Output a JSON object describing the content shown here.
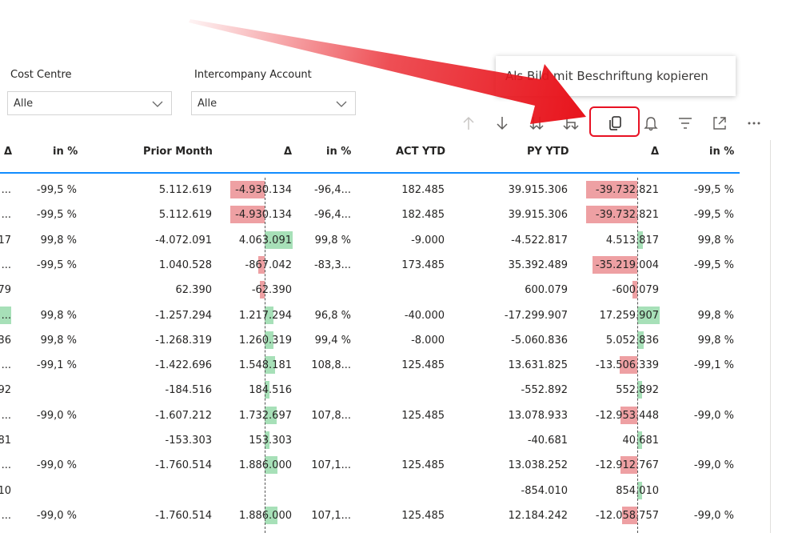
{
  "filters": {
    "cost_centre": {
      "label": "Cost Centre",
      "value": "Alle"
    },
    "intercompany": {
      "label": "Intercompany Account",
      "value": "Alle"
    }
  },
  "tooltip": {
    "text": "Als Bild mit Beschriftung kopieren"
  },
  "toolbar": {
    "icons": [
      "arrow-up-icon",
      "arrow-down-icon",
      "drill-all-down-icon",
      "expand-next-level-icon",
      "copy-icon",
      "bell-icon",
      "filter-icon",
      "focus-mode-icon",
      "more-options-icon"
    ],
    "highlight_color": "#e81123",
    "arrow_color": "#e8141c"
  },
  "table": {
    "headers": [
      "Δ",
      "in %",
      "Prior Month",
      "Δ",
      "in %",
      "ACT YTD",
      "PY YTD",
      "Δ",
      "in %"
    ],
    "colors": {
      "negative": "#eea0a3",
      "positive": "#a7e0b8",
      "header_line": "#118dff"
    },
    "rows": [
      {
        "c1": "...",
        "c2": "-99,5 %",
        "pm": "5.112.619",
        "pm_delta": "-4.930.134",
        "pm_delta_val": -4930134,
        "pm_pct": "-96,4...",
        "act": "182.485",
        "py": "39.915.306",
        "py_delta": "-39.732.821",
        "py_delta_val": -39732821,
        "py_pct": "-99,5 %"
      },
      {
        "c1": "...",
        "c2": "-99,5 %",
        "pm": "5.112.619",
        "pm_delta": "-4.930.134",
        "pm_delta_val": -4930134,
        "pm_pct": "-96,4...",
        "act": "182.485",
        "py": "39.915.306",
        "py_delta": "-39.732.821",
        "py_delta_val": -39732821,
        "py_pct": "-99,5 %"
      },
      {
        "c1": "17",
        "c2": "99,8 %",
        "pm": "-4.072.091",
        "pm_delta": "4.063.091",
        "pm_delta_val": 4063091,
        "pm_pct": "99,8 %",
        "act": "-9.000",
        "py": "-4.522.817",
        "py_delta": "4.513.817",
        "py_delta_val": 4513817,
        "py_pct": "99,8 %"
      },
      {
        "c1": "...",
        "c2": "-99,5 %",
        "pm": "1.040.528",
        "pm_delta": "-867.042",
        "pm_delta_val": -867042,
        "pm_pct": "-83,3...",
        "act": "173.485",
        "py": "35.392.489",
        "py_delta": "-35.219.004",
        "py_delta_val": -35219004,
        "py_pct": "-99,5 %"
      },
      {
        "c1": "79",
        "c2": "",
        "pm": "62.390",
        "pm_delta": "-62.390",
        "pm_delta_val": -62390,
        "pm_pct": "",
        "act": "",
        "py": "600.079",
        "py_delta": "-600.079",
        "py_delta_val": -600079,
        "py_pct": ""
      },
      {
        "c1": "...",
        "c1_bar": true,
        "c2": "99,8 %",
        "pm": "-1.257.294",
        "pm_delta": "1.217.294",
        "pm_delta_val": 1217294,
        "pm_pct": "96,8 %",
        "act": "-40.000",
        "py": "-17.299.907",
        "py_delta": "17.259.907",
        "py_delta_val": 17259907,
        "py_pct": "99,8 %"
      },
      {
        "c1": "36",
        "c2": "99,8 %",
        "pm": "-1.268.319",
        "pm_delta": "1.260.319",
        "pm_delta_val": 1260319,
        "pm_pct": "99,4 %",
        "act": "-8.000",
        "py": "-5.060.836",
        "py_delta": "5.052.836",
        "py_delta_val": 5052836,
        "py_pct": "99,8 %"
      },
      {
        "c1": "...",
        "c2": "-99,1 %",
        "pm": "-1.422.696",
        "pm_delta": "1.548.181",
        "pm_delta_val": 1548181,
        "pm_pct": "108,8...",
        "act": "125.485",
        "py": "13.631.825",
        "py_delta": "-13.506.339",
        "py_delta_val": -13506339,
        "py_pct": "-99,1 %"
      },
      {
        "c1": "92",
        "c2": "",
        "pm": "-184.516",
        "pm_delta": "184.516",
        "pm_delta_val": 184516,
        "pm_pct": "",
        "act": "",
        "py": "-552.892",
        "py_delta": "552.892",
        "py_delta_val": 552892,
        "py_pct": ""
      },
      {
        "c1": "...",
        "c2": "-99,0 %",
        "pm": "-1.607.212",
        "pm_delta": "1.732.697",
        "pm_delta_val": 1732697,
        "pm_pct": "107,8...",
        "act": "125.485",
        "py": "13.078.933",
        "py_delta": "-12.953.448",
        "py_delta_val": -12953448,
        "py_pct": "-99,0 %"
      },
      {
        "c1": "81",
        "c2": "",
        "pm": "-153.303",
        "pm_delta": "153.303",
        "pm_delta_val": 153303,
        "pm_pct": "",
        "act": "",
        "py": "-40.681",
        "py_delta": "40.681",
        "py_delta_val": 40681,
        "py_pct": ""
      },
      {
        "c1": "...",
        "c2": "-99,0 %",
        "pm": "-1.760.514",
        "pm_delta": "1.886.000",
        "pm_delta_val": 1886000,
        "pm_pct": "107,1...",
        "act": "125.485",
        "py": "13.038.252",
        "py_delta": "-12.912.767",
        "py_delta_val": -12912767,
        "py_pct": "-99,0 %"
      },
      {
        "c1": "10",
        "c2": "",
        "pm": "",
        "pm_delta": "",
        "pm_delta_val": 0,
        "pm_pct": "",
        "act": "",
        "py": "-854.010",
        "py_delta": "854.010",
        "py_delta_val": 854010,
        "py_pct": ""
      },
      {
        "c1": "...",
        "c2": "-99,0 %",
        "pm": "-1.760.514",
        "pm_delta": "1.886.000",
        "pm_delta_val": 1886000,
        "pm_pct": "107,1...",
        "act": "125.485",
        "py": "12.184.242",
        "py_delta": "-12.058.757",
        "py_delta_val": -12058757,
        "py_pct": "-99,0 %"
      }
    ]
  }
}
